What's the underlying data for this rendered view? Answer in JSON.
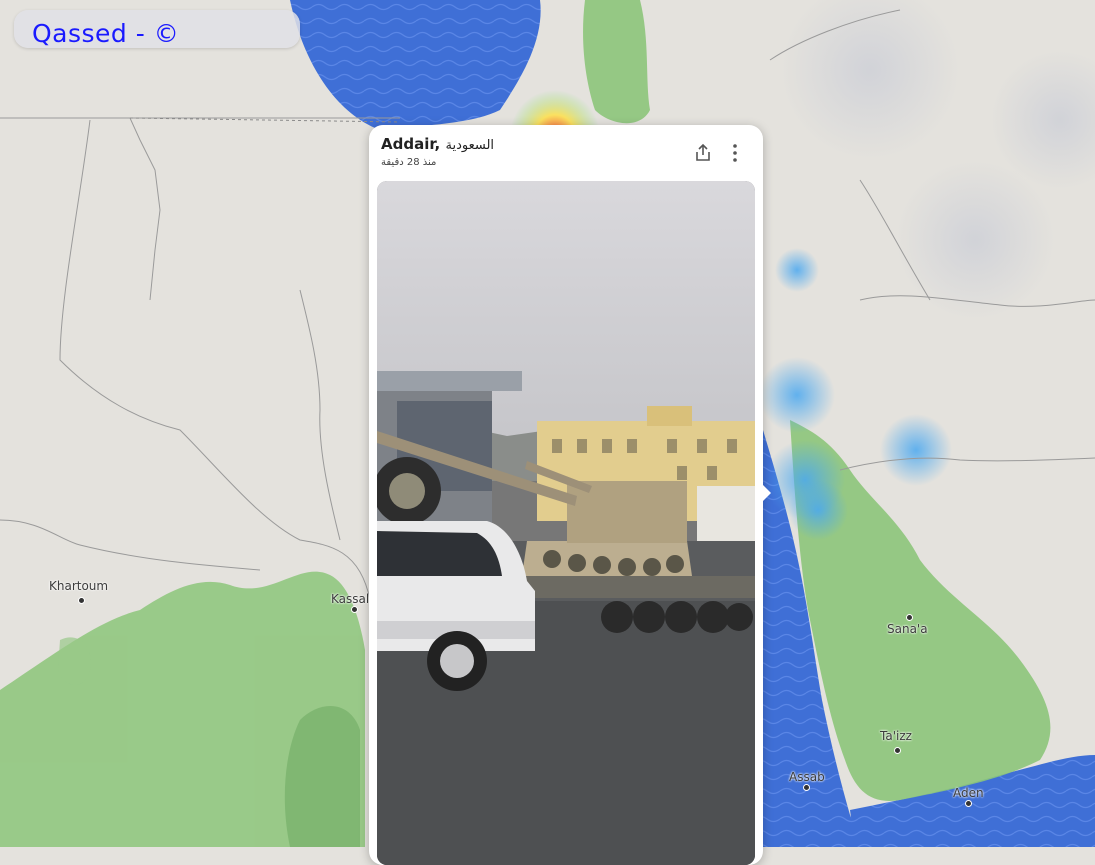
{
  "watermark": {
    "text": "Qassed - ©",
    "text_color": "#1a1aff"
  },
  "map": {
    "water_color": "#3f6fd6",
    "land_color": "#e4e2dd",
    "vegetation_color": "#8cc57a",
    "places": [
      {
        "name": "Khartoum"
      },
      {
        "name": "Kassal"
      },
      {
        "name": "Sana'a"
      },
      {
        "name": "Ta'izz"
      },
      {
        "name": "Assab"
      },
      {
        "name": "Aden"
      }
    ]
  },
  "card": {
    "place": "Addair,",
    "country": "السعودية",
    "time_ago": "منذ 28 دقيقة",
    "share_icon": "share-icon",
    "more_icon": "more-vert-icon",
    "media_subject": "video-thumbnail"
  }
}
